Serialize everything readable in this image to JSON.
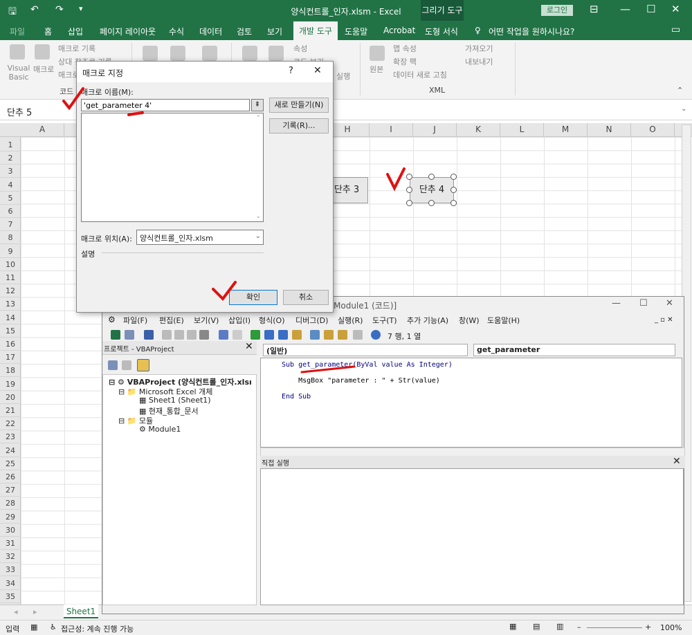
{
  "excel": {
    "window_title": "양식컨트롤_인자.xlsm  -  Excel",
    "context_tab": "그리기 도구",
    "login": "로그인",
    "tabs": [
      "파일",
      "홈",
      "삽입",
      "페이지 레이아웃",
      "수식",
      "데이터",
      "검토",
      "보기",
      "개발 도구",
      "도움말",
      "Acrobat",
      "도형 서식"
    ],
    "tell_me": "어떤 작업을 원하시나요?",
    "ribbon": {
      "visual_basic": "Visual Basic",
      "macro": "매크로",
      "record_macro": "매크로 기록",
      "relative_ref": "상대 참조로 기록",
      "macro_security": "매크로 보안",
      "group_code": "코드",
      "properties": "속성",
      "view_code": "코드 보기",
      "run_dialog": "실행",
      "source": "원본",
      "map_properties": "맵 속성",
      "expansion_packs": "확장 팩",
      "refresh_data": "데이터 새로 고침",
      "import": "가져오기",
      "export": "내보내기",
      "group_xml": "XML"
    },
    "name_box": "단추 5",
    "columns": [
      "A",
      "B",
      "C",
      "D",
      "E",
      "F",
      "G",
      "H",
      "I",
      "J",
      "K",
      "L",
      "M",
      "N",
      "O"
    ],
    "rows": [
      "1",
      "2",
      "3",
      "4",
      "5",
      "6",
      "7",
      "8",
      "9",
      "10",
      "11",
      "12",
      "13",
      "14",
      "15",
      "16",
      "17",
      "18",
      "19",
      "20",
      "21",
      "22",
      "23",
      "24",
      "25",
      "26",
      "27",
      "28",
      "29",
      "30",
      "31",
      "32",
      "33",
      "34",
      "35"
    ],
    "buttons": {
      "btn3": "단추 3",
      "btn4": "단추 4"
    },
    "sheet_tab": "Sheet1",
    "status": {
      "mode": "입력",
      "accessibility": "접근성: 계속 진행 가능",
      "zoom": "100%"
    }
  },
  "dialog": {
    "title": "매크로 지정",
    "help": "?",
    "name_label": "매크로 이름(M):",
    "name_value": "'get_parameter 4'",
    "new_button": "새로 만들기(N)",
    "record_button": "기록(R)...",
    "location_label": "매크로 위치(A):",
    "location_value": "양식컨트롤_인자.xlsm",
    "description_label": "설명",
    "ok": "확인",
    "cancel": "취소"
  },
  "vbe": {
    "title": "Module1 (코드)]",
    "menus": [
      "파일(F)",
      "편집(E)",
      "보기(V)",
      "삽입(I)",
      "형식(O)",
      "디버그(D)",
      "실행(R)",
      "도구(T)",
      "추가 기능(A)",
      "창(W)",
      "도움말(H)"
    ],
    "position": "7 행, 1 열",
    "project_title": "프로젝트 - VBAProject",
    "tree": [
      "VBAProject (양식컨트롤_인자.xlsı",
      "Microsoft Excel 개체",
      "Sheet1 (Sheet1)",
      "현재_통합_문서",
      "모듈",
      "Module1"
    ],
    "object_combo": "(일반)",
    "proc_combo": "get_parameter",
    "code": [
      "Sub get_parameter(ByVal value As Integer)",
      "    MsgBox \"parameter : \" + Str(value)",
      "End Sub"
    ],
    "immediate_title": "직접 실행"
  },
  "colors": {
    "excel_green": "#217346",
    "annotation_red": "#e01010"
  }
}
